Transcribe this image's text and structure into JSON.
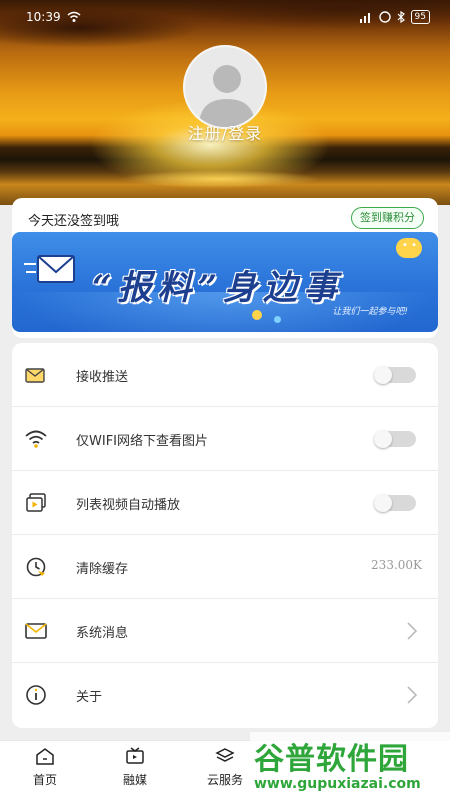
{
  "status_bar": {
    "time": "10:39",
    "battery": "95"
  },
  "profile": {
    "login_text": "注册/登录"
  },
  "checkin": {
    "prompt": "今天还没签到哦",
    "button": "签到赚积分"
  },
  "banner": {
    "title": "“报料”身边事",
    "subtitle": "让我们一起参与吧!"
  },
  "settings": [
    {
      "icon": "mail-push-icon",
      "label": "接收推送",
      "control": "toggle",
      "on": false
    },
    {
      "icon": "wifi-icon",
      "label": "仅WIFI网络下查看图片",
      "control": "toggle",
      "on": false
    },
    {
      "icon": "video-autoplay-icon",
      "label": "列表视频自动播放",
      "control": "toggle",
      "on": false
    },
    {
      "icon": "clock-clear-icon",
      "label": "清除缓存",
      "control": "value",
      "value": "233.00K"
    },
    {
      "icon": "mail-icon",
      "label": "系统消息",
      "control": "chevron"
    },
    {
      "icon": "info-icon",
      "label": "关于",
      "control": "chevron"
    }
  ],
  "tabs": [
    {
      "icon": "home-icon",
      "label": "首页"
    },
    {
      "icon": "tv-icon",
      "label": "融媒"
    },
    {
      "icon": "layers-icon",
      "label": "云服务"
    }
  ],
  "watermark": {
    "logo": "谷普软件园",
    "url": "www.gupuxiazai.com"
  },
  "colors": {
    "accent_green": "#3ca94b",
    "banner_blue": "#2a73d9"
  }
}
